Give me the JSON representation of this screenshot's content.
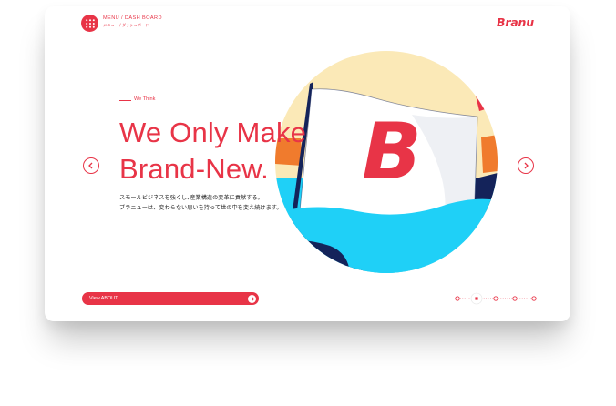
{
  "header": {
    "menu_title": "MENU / DASH BOARD",
    "menu_subtitle": "メニュー / ダッシュボード",
    "logo": "Branu"
  },
  "hero": {
    "eyebrow": "We Think",
    "headline_line1": "We Only Make",
    "headline_line2": "Brand-New.",
    "description_line1": "スモールビジネスを強くし､産業構造の変革に貢献する｡",
    "description_line2": "ブラニューは、変わらない思いを持って世の中を変え続けます。"
  },
  "cta": {
    "label": "View ABOUT"
  },
  "carousel": {
    "slide_count": 5,
    "active_index": 1
  },
  "colors": {
    "accent": "#e83447",
    "sky": "#fbe9b7",
    "sea": "#1fd0f7",
    "navy": "#14235a",
    "orange": "#f07b2d"
  },
  "icons": {
    "menu": "grid-icon",
    "prev": "chevron-left-icon",
    "next": "chevron-right-icon",
    "cta": "chevron-right-icon"
  }
}
